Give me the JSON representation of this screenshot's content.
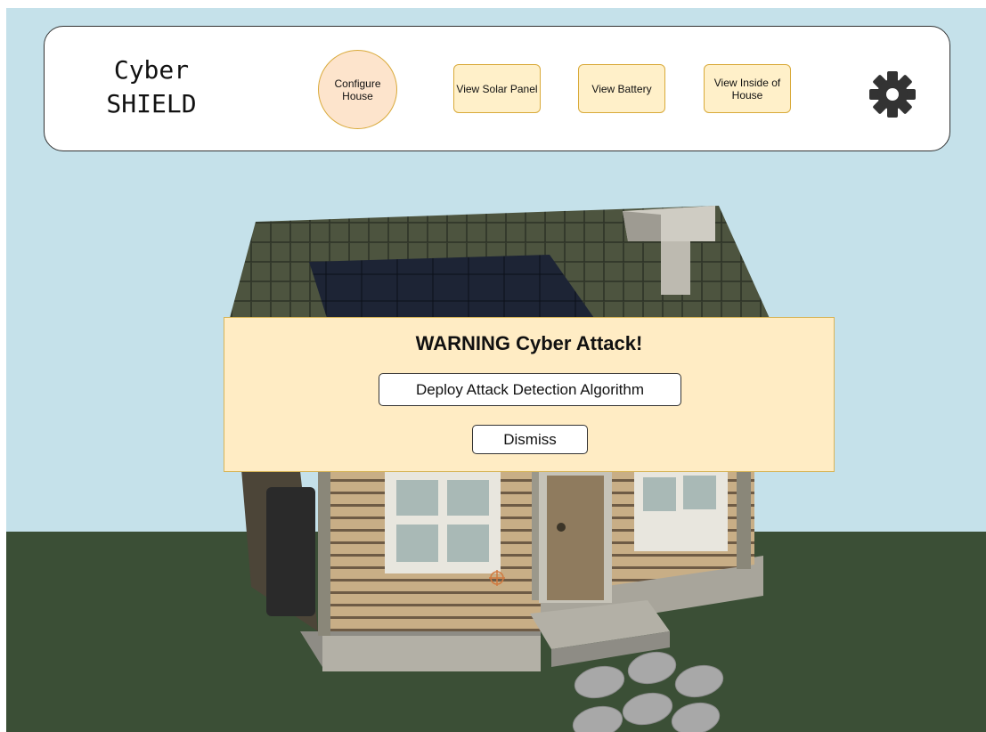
{
  "app": {
    "logo_line1": "Cyber",
    "logo_line2": "SHIELD"
  },
  "nav": {
    "configure_house": "Configure House",
    "view_solar_panel": "View Solar Panel",
    "view_battery": "View Battery",
    "view_inside": "View Inside of House",
    "settings_icon": "gear-icon"
  },
  "alert": {
    "title": "WARNING Cyber Attack!",
    "deploy_label": "Deploy Attack Detection Algorithm",
    "dismiss_label": "Dismiss"
  },
  "colors": {
    "sky": "#c5e1ea",
    "ground": "#3b4f36",
    "nav_button": "#fff0c9",
    "nav_button_active": "#fde4cc",
    "alert_bg": "#ffecc4"
  }
}
